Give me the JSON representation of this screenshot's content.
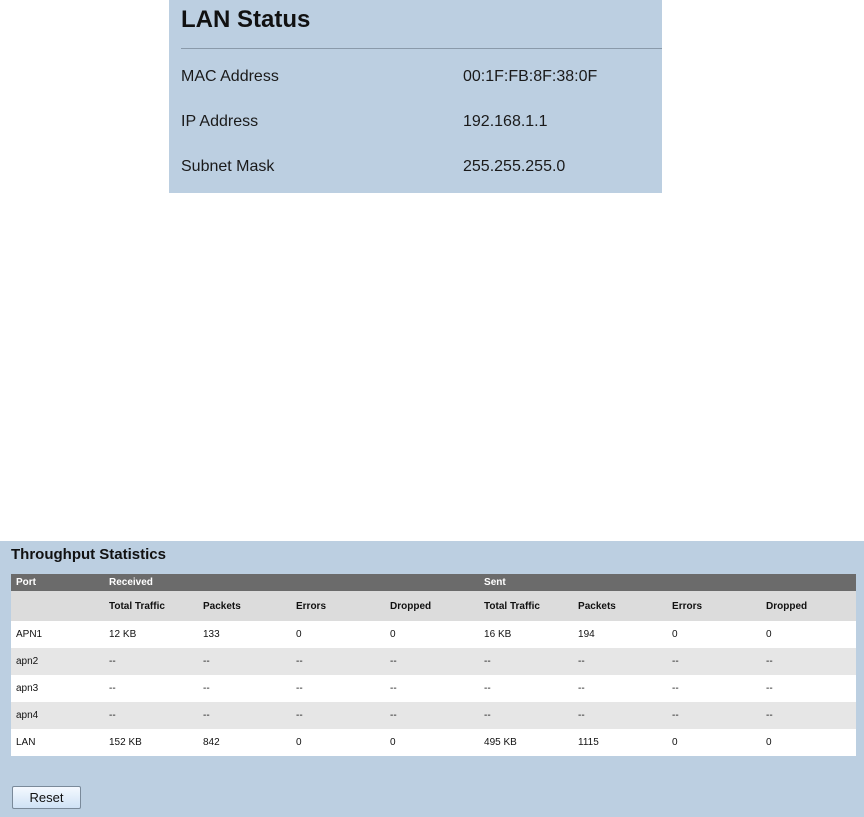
{
  "lan_status": {
    "title": "LAN Status",
    "rows": [
      {
        "label": "MAC Address",
        "value": "00:1F:FB:8F:38:0F"
      },
      {
        "label": "IP Address",
        "value": "192.168.1.1"
      },
      {
        "label": "Subnet Mask",
        "value": "255.255.255.0"
      }
    ]
  },
  "throughput": {
    "title": "Throughput Statistics",
    "header_top": {
      "port": "Port",
      "received": "Received",
      "sent": "Sent"
    },
    "subheaders": [
      "Total Traffic",
      "Packets",
      "Errors",
      "Dropped",
      "Total Traffic",
      "Packets",
      "Errors",
      "Dropped"
    ],
    "rows": [
      [
        "APN1",
        "12 KB",
        "133",
        "0",
        "0",
        "16 KB",
        "194",
        "0",
        "0"
      ],
      [
        "apn2",
        "--",
        "--",
        "--",
        "--",
        "--",
        "--",
        "--",
        "--"
      ],
      [
        "apn3",
        "--",
        "--",
        "--",
        "--",
        "--",
        "--",
        "--",
        "--"
      ],
      [
        "apn4",
        "--",
        "--",
        "--",
        "--",
        "--",
        "--",
        "--",
        "--"
      ],
      [
        "LAN",
        "152 KB",
        "842",
        "0",
        "0",
        "495 KB",
        "1115",
        "0",
        "0"
      ]
    ],
    "reset_label": "Reset"
  }
}
